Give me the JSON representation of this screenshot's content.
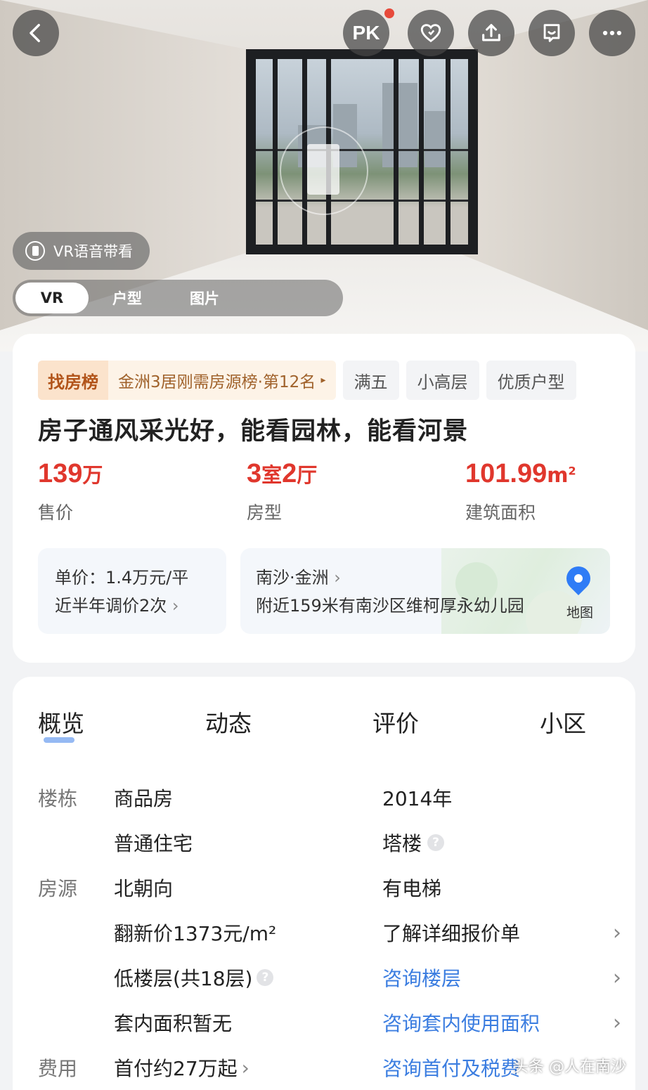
{
  "header": {
    "pk_label": "PK",
    "vr_voice_label": "VR语音带看",
    "media_tabs": [
      "VR",
      "户型",
      "图片"
    ]
  },
  "tags": {
    "rank_badge": "找房榜",
    "rank_text": "金洲3居刚需房源榜·第12名",
    "items": [
      "满五",
      "小高层",
      "优质户型"
    ]
  },
  "listing": {
    "title": "房子通风采光好，能看园林，能看河景",
    "price_value": "139",
    "price_unit": "万",
    "price_label": "售价",
    "layout_room_num": "3",
    "layout_room_unit": "室",
    "layout_hall_num": "2",
    "layout_hall_unit": "厅",
    "layout_label": "房型",
    "area_value": "101.99",
    "area_unit": "m",
    "area_unit_sup": "2",
    "area_label": "建筑面积"
  },
  "price_box": {
    "unit_price": "单价：1.4万元/平",
    "adjust": "近半年调价2次"
  },
  "location_box": {
    "district": "南沙·金洲",
    "nearby": "附近159米有南沙区维柯厚永幼儿园",
    "map_label": "地图"
  },
  "detail_nav": [
    "概览",
    "动态",
    "评价",
    "小区"
  ],
  "details": {
    "labels": {
      "building": "楼栋",
      "source": "房源",
      "cost": "费用"
    },
    "rows": [
      {
        "left": "商品房",
        "right": "2014年"
      },
      {
        "left": "普通住宅",
        "right": "塔楼"
      },
      {
        "left": "北朝向",
        "right": "有电梯"
      },
      {
        "left": "翻新价1373元/m²",
        "right": "了解详细报价单"
      },
      {
        "left": "低楼层(共18层)",
        "right": "咨询楼层"
      },
      {
        "left": "套内面积暂无",
        "right": "咨询套内使用面积"
      },
      {
        "left": "首付约27万起",
        "right": "咨询首付及税费"
      }
    ]
  },
  "watermark": "头条 @人在南沙",
  "colors": {
    "price_red": "#e0372d",
    "link_blue": "#3b7de0",
    "rank_brown": "#b2541a"
  }
}
